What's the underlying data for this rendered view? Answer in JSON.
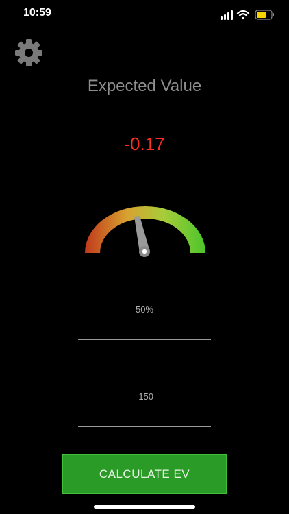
{
  "status_bar": {
    "time": "10:59",
    "icons": [
      "cellular-signal-icon",
      "wifi-icon",
      "battery-icon"
    ],
    "battery_color": "#f5d400"
  },
  "settings": {
    "icon": "gear-icon",
    "color": "#7a7a7a"
  },
  "header": {
    "title": "Expected Value"
  },
  "result": {
    "ev": "-0.17",
    "color": "#ff2d20"
  },
  "gauge": {
    "level": 0.41,
    "gradient_colors": [
      "#c0391c",
      "#d8a230",
      "#a8cc3a",
      "#4cc52b"
    ]
  },
  "inputs": {
    "probability": "50%",
    "odds": "-150"
  },
  "actions": {
    "calculate_label": "CALCULATE EV",
    "button_color": "#2a9b26"
  }
}
